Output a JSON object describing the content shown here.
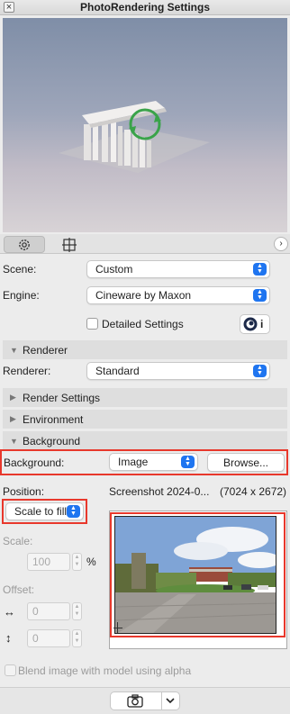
{
  "window": {
    "title": "PhotoRendering Settings",
    "close_glyph": "×"
  },
  "tabs": [
    {
      "name": "settings",
      "icon": "gear-icon",
      "active": true
    },
    {
      "name": "viewport",
      "icon": "crop-frame-icon",
      "active": false
    }
  ],
  "expand_glyph": "›",
  "scene": {
    "label": "Scene:",
    "value": "Custom"
  },
  "engine": {
    "label": "Engine:",
    "value": "Cineware by Maxon"
  },
  "detailed_settings": {
    "label": "Detailed Settings",
    "checked": false,
    "info_glyph": "i"
  },
  "sections": {
    "renderer": "Renderer",
    "render_settings": "Render Settings",
    "environment": "Environment",
    "background": "Background"
  },
  "renderer": {
    "label": "Renderer:",
    "value": "Standard"
  },
  "background": {
    "label": "Background:",
    "value": "Image",
    "browse_label": "Browse..."
  },
  "position": {
    "label": "Position:",
    "value": "Scale to fill"
  },
  "image_info": {
    "filename": "Screenshot 2024-0...",
    "dimensions": "(7024 x 2672)"
  },
  "scale": {
    "label": "Scale:",
    "value": "100",
    "unit": "%"
  },
  "offset": {
    "label": "Offset:",
    "x_glyph": "↔",
    "y_glyph": "↕",
    "x_value": "0",
    "y_value": "0"
  },
  "blend": {
    "label": "Blend image with model using alpha",
    "checked": false
  },
  "accent_color": "#1f75f0",
  "highlight_color": "#e8382c"
}
